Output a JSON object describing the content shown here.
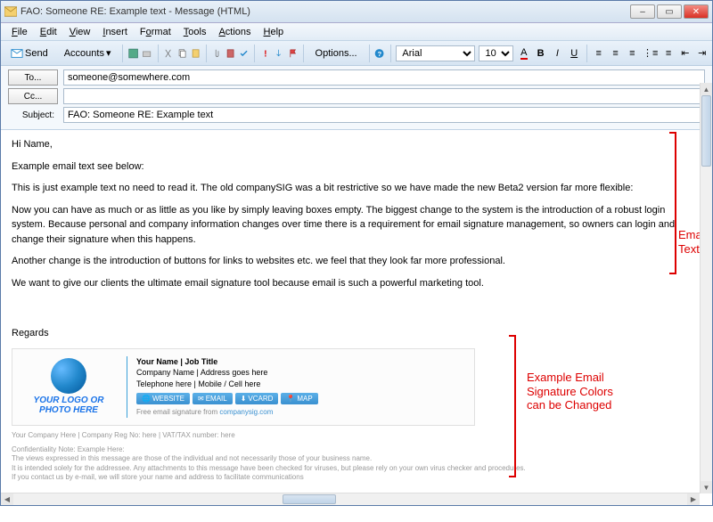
{
  "window": {
    "title": "FAO: Someone RE: Example text - Message (HTML)"
  },
  "menu": {
    "file": "File",
    "edit": "Edit",
    "view": "View",
    "insert": "Insert",
    "format": "Format",
    "tools": "Tools",
    "actions": "Actions",
    "help": "Help"
  },
  "toolbar": {
    "send": "Send",
    "accounts": "Accounts",
    "options": "Options...",
    "font": "Arial",
    "size": "10"
  },
  "headers": {
    "to_label": "To...",
    "to_value": "someone@somewhere.com",
    "cc_label": "Cc...",
    "cc_value": "",
    "subject_label": "Subject:",
    "subject_value": "FAO: Someone RE: Example text"
  },
  "body": {
    "greeting": "Hi Name,",
    "p1": "Example email text see below:",
    "p2": "This is just example text no need to read it.  The old companySIG was a bit restrictive so we have made the new Beta2 version far more flexible:",
    "p3": "Now you can have as much or as little as you like by simply leaving boxes empty. The biggest change to the system is the introduction of a robust login system. Because personal and company information changes over time there is a requirement for email signature management, so owners can login and change their signature when this happens.",
    "p4": "Another change is the introduction of buttons for links to websites etc. we feel that they look far more professional.",
    "p5": "We want to give our clients the ultimate email signature tool because email is such a powerful marketing tool.",
    "regards": "Regards"
  },
  "signature": {
    "logo_text": "YOUR LOGO OR PHOTO HERE",
    "name_line": "Your Name | Job Title",
    "company_line": "Company Name | Address goes here",
    "phone_line": "Telephone here | Mobile / Cell here",
    "btn_website": "WEBSITE",
    "btn_email": "EMAIL",
    "btn_vcard": "VCARD",
    "btn_map": "MAP",
    "free_text": "Free email signature from ",
    "free_link": "companysig.com"
  },
  "footer": {
    "l1": "Your Company Here | Company Reg No: here | VAT/TAX number: here",
    "l2": "Confidentiality Note:  Example Here:",
    "l3": "The views expressed in this message are those of the individual and not necessarily those of your business name.",
    "l4": "It is intended solely for the addressee. Any attachments to this message have been checked for viruses, but please rely on your own virus checker and procedures.",
    "l5": "If you contact us by e-mail, we will store your name and address to facilitate communications"
  },
  "annotations": {
    "email_text": "Email Text",
    "sig_text": "Example Email Signature Colors can be Changed"
  }
}
